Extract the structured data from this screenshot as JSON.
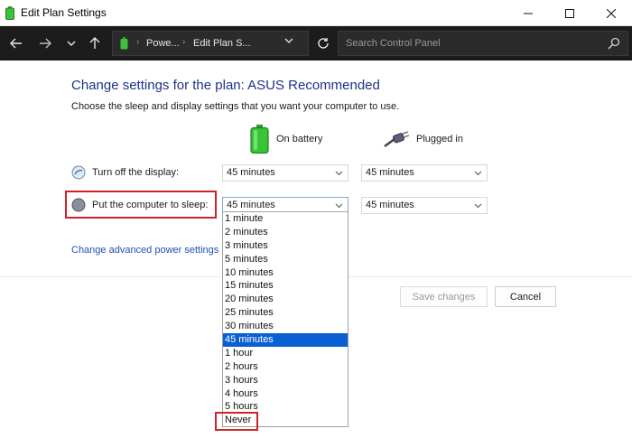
{
  "window": {
    "title": "Edit Plan Settings"
  },
  "nav": {
    "crumbs": [
      "Powe...",
      "Edit Plan S..."
    ],
    "search_placeholder": "Search Control Panel"
  },
  "page": {
    "heading": "Change settings for the plan: ASUS Recommended",
    "subtext": "Choose the sleep and display settings that you want your computer to use.",
    "col_battery": "On battery",
    "col_plugged": "Plugged in",
    "display_label": "Turn off the display:",
    "sleep_label": "Put the computer to sleep:",
    "display_battery": "45 minutes",
    "display_plugged": "45 minutes",
    "sleep_battery": "45 minutes",
    "sleep_plugged": "45 minutes",
    "advanced_link": "Change advanced power settings",
    "save_button": "Save changes",
    "cancel_button": "Cancel"
  },
  "dropdown": {
    "items": [
      "1 minute",
      "2 minutes",
      "3 minutes",
      "5 minutes",
      "10 minutes",
      "15 minutes",
      "20 minutes",
      "25 minutes",
      "30 minutes",
      "45 minutes",
      "1 hour",
      "2 hours",
      "3 hours",
      "4 hours",
      "5 hours",
      "Never"
    ],
    "selected": "45 minutes",
    "highlighted": "Never"
  },
  "colors": {
    "accent": "#0a5fd3",
    "heading": "#1e3287",
    "highlight_box": "#d0202a"
  },
  "icons": [
    "battery-icon",
    "back-arrow-icon",
    "forward-arrow-icon",
    "chevron-down-icon",
    "up-arrow-icon",
    "refresh-icon",
    "search-icon",
    "minimize-icon",
    "maximize-icon",
    "close-icon",
    "display-icon",
    "sleep-moon-icon",
    "power-plug-icon"
  ]
}
